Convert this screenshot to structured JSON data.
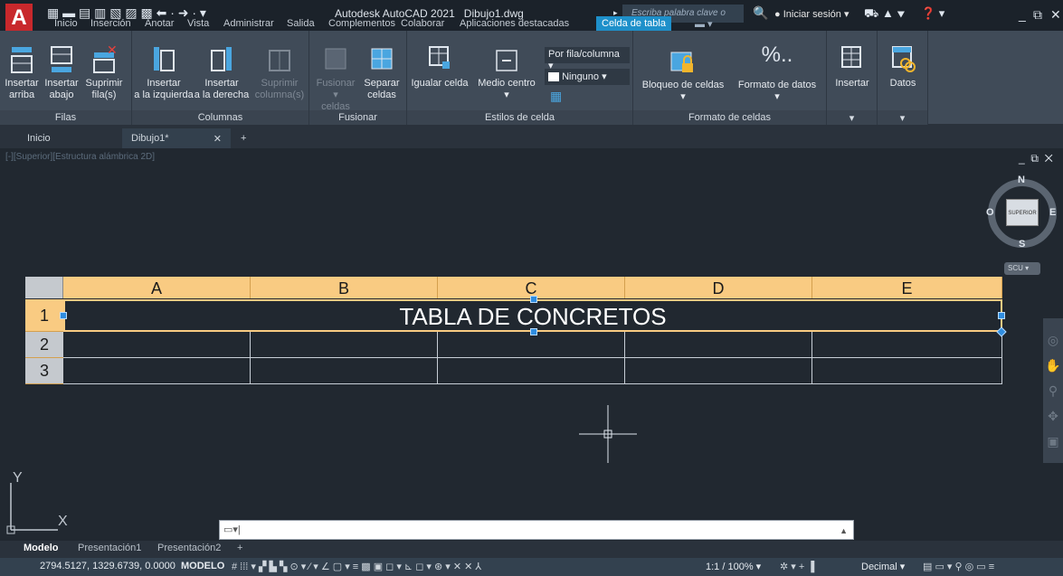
{
  "app": {
    "logo_letter": "A",
    "title": "Autodesk AutoCAD 2021",
    "filename": "Dibujo1.dwg",
    "search_placeholder": "Escriba palabra clave o frase",
    "login": "Iniciar sesión"
  },
  "ribbon_tabs": [
    "Inicio",
    "Inserción",
    "Anotar",
    "Vista",
    "Administrar",
    "Salida",
    "Complementos",
    "Colaborar",
    "Aplicaciones destacadas",
    "Celda de tabla"
  ],
  "ribbon": {
    "filas": {
      "title": "Filas",
      "insert_above": [
        "Insertar",
        "arriba"
      ],
      "insert_below": [
        "Insertar",
        "abajo"
      ],
      "delete_rows": [
        "Suprimir",
        "fila(s)"
      ]
    },
    "columnas": {
      "title": "Columnas",
      "insert_left": [
        "Insertar",
        "a la izquierda"
      ],
      "insert_right": [
        "Insertar",
        "a la derecha"
      ],
      "delete_cols": [
        "Suprimir",
        "columna(s)"
      ]
    },
    "fusionar": {
      "title": "Fusionar",
      "merge": [
        "Fusionar",
        "celdas"
      ],
      "unmerge": [
        "Separar",
        "celdas"
      ]
    },
    "estilos": {
      "title": "Estilos de celda",
      "match_cell": "Igualar celda",
      "middle_center": "Medio centro",
      "by_rowcol": "Por fila/columna",
      "none": "Ninguno"
    },
    "formato": {
      "title": "Formato de celdas",
      "cell_lock": "Bloqueo de celdas",
      "data_format": "Formato de datos"
    },
    "insertar": {
      "label": "Insertar"
    },
    "datos": {
      "label": "Datos"
    }
  },
  "file_tabs": {
    "home": "Inicio",
    "drawing": "Dibujo1*"
  },
  "viewport": {
    "label": "[-][Superior][Estructura alámbrica 2D]"
  },
  "viewcube": {
    "n": "N",
    "e": "E",
    "s": "S",
    "o": "O",
    "face": "SUPERIOR",
    "ucs": "SCU"
  },
  "table": {
    "columns": [
      "A",
      "B",
      "C",
      "D",
      "E"
    ],
    "rows": [
      "1",
      "2",
      "3"
    ],
    "title": "TABLA DE CONCRETOS"
  },
  "ucs_axes": {
    "x": "X",
    "y": "Y"
  },
  "layout_tabs": [
    "Modelo",
    "Presentación1",
    "Presentación2"
  ],
  "status": {
    "coords": "2794.5127, 1329.6739, 0.0000",
    "space": "MODELO",
    "scale": "1:1 / 100%",
    "units": "Decimal"
  },
  "colors": {
    "accent": "#1e90ca",
    "table_header": "#f9cb82",
    "background": "#212830"
  }
}
